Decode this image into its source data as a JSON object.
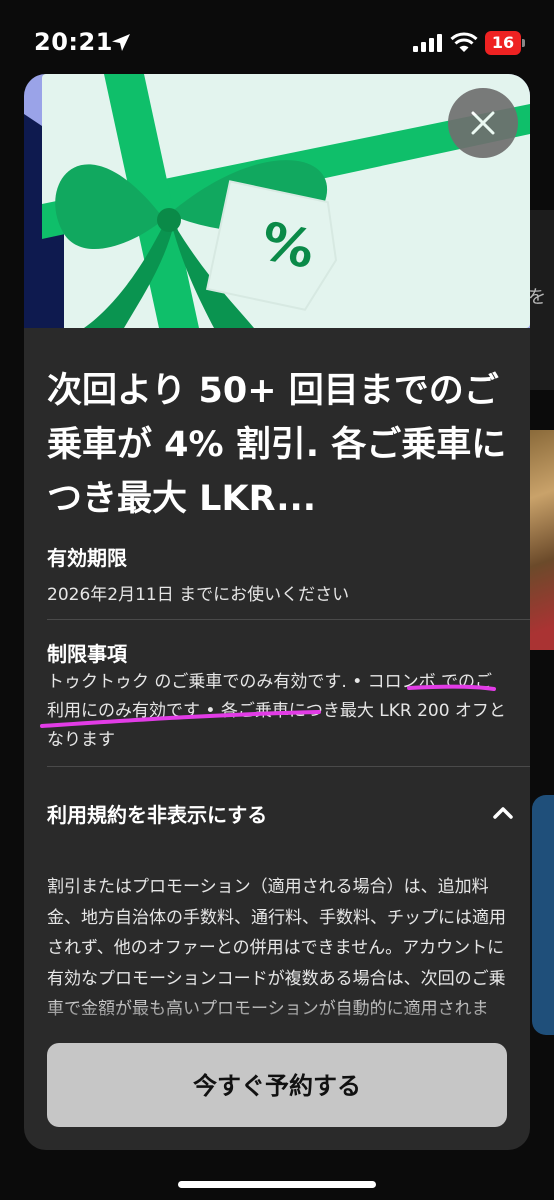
{
  "status_bar": {
    "time": "20:21",
    "battery": "16",
    "battery_color": "#e02020"
  },
  "background": {
    "peek_text": "を"
  },
  "modal": {
    "headline": "次回より 50+ 回目までのご乗車が 4% 割引. 各ご乗車につき最大 LKR...",
    "validity": {
      "title": "有効期限",
      "body": "2026年2月11日 までにお使いください"
    },
    "restrictions": {
      "title": "制限事項",
      "part1": "トゥクトゥク のご乗車でのみ有効です. ",
      "part2_highlight": "• コロンボ でのご利用にのみ有効です",
      "part3": " • 各ご乗車につき最大 LKR 200 オフとなります",
      "highlight_color": "#e23ce6"
    },
    "terms": {
      "toggle_label": "利用規約を非表示にする",
      "text": "割引またはプロモーション（適用される場合）は、追加料金、地方自治体の手数料、通行料、手数料、チップには適用されず、他のオファーとの併用はできません。アカウントに有効なプロモーションコードが複数ある場合は、次回のご乗車で金額が最も高いプロモーションが自動的に適用されます。"
    },
    "cta_label": "今すぐ予約する",
    "hero": {
      "tag_symbol": "%",
      "ribbon_color": "#0fbf6a",
      "card_color": "#e3f4ee",
      "frame_color": "#9aa3e8",
      "navy_color": "#0e1a4f"
    }
  }
}
